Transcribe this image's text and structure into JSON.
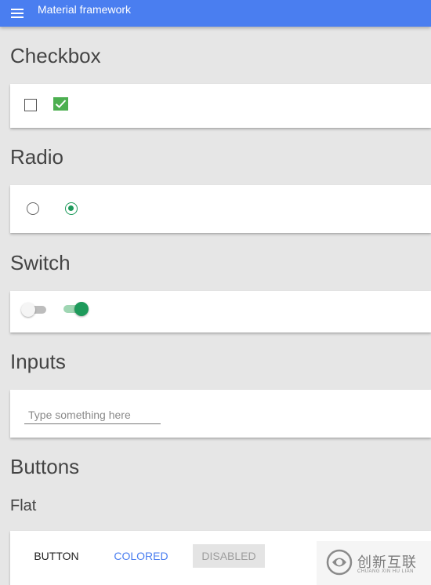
{
  "app_bar": {
    "title": "Material framework",
    "menu_icon": "menu-icon",
    "color": "#4a7ef0"
  },
  "sections": {
    "checkbox": {
      "title": "Checkbox",
      "items": [
        {
          "checked": false
        },
        {
          "checked": true
        }
      ]
    },
    "radio": {
      "title": "Radio",
      "items": [
        {
          "selected": false
        },
        {
          "selected": true
        }
      ]
    },
    "switch": {
      "title": "Switch",
      "items": [
        {
          "on": false
        },
        {
          "on": true
        }
      ]
    },
    "inputs": {
      "title": "Inputs",
      "text_field": {
        "placeholder": "Type something here",
        "value": ""
      }
    },
    "buttons": {
      "title": "Buttons",
      "flat": {
        "subtitle": "Flat",
        "button_label": "BUTTON",
        "colored_label": "COLORED",
        "disabled_label": "DISABLED"
      }
    }
  },
  "colors": {
    "accent_green": "#1e9a5b",
    "checkbox_green": "#4caf50",
    "primary_blue": "#4a7ef0"
  },
  "watermark": {
    "text_cn": "创新互联",
    "text_en": "CHUANG XIN HU LIAN"
  }
}
